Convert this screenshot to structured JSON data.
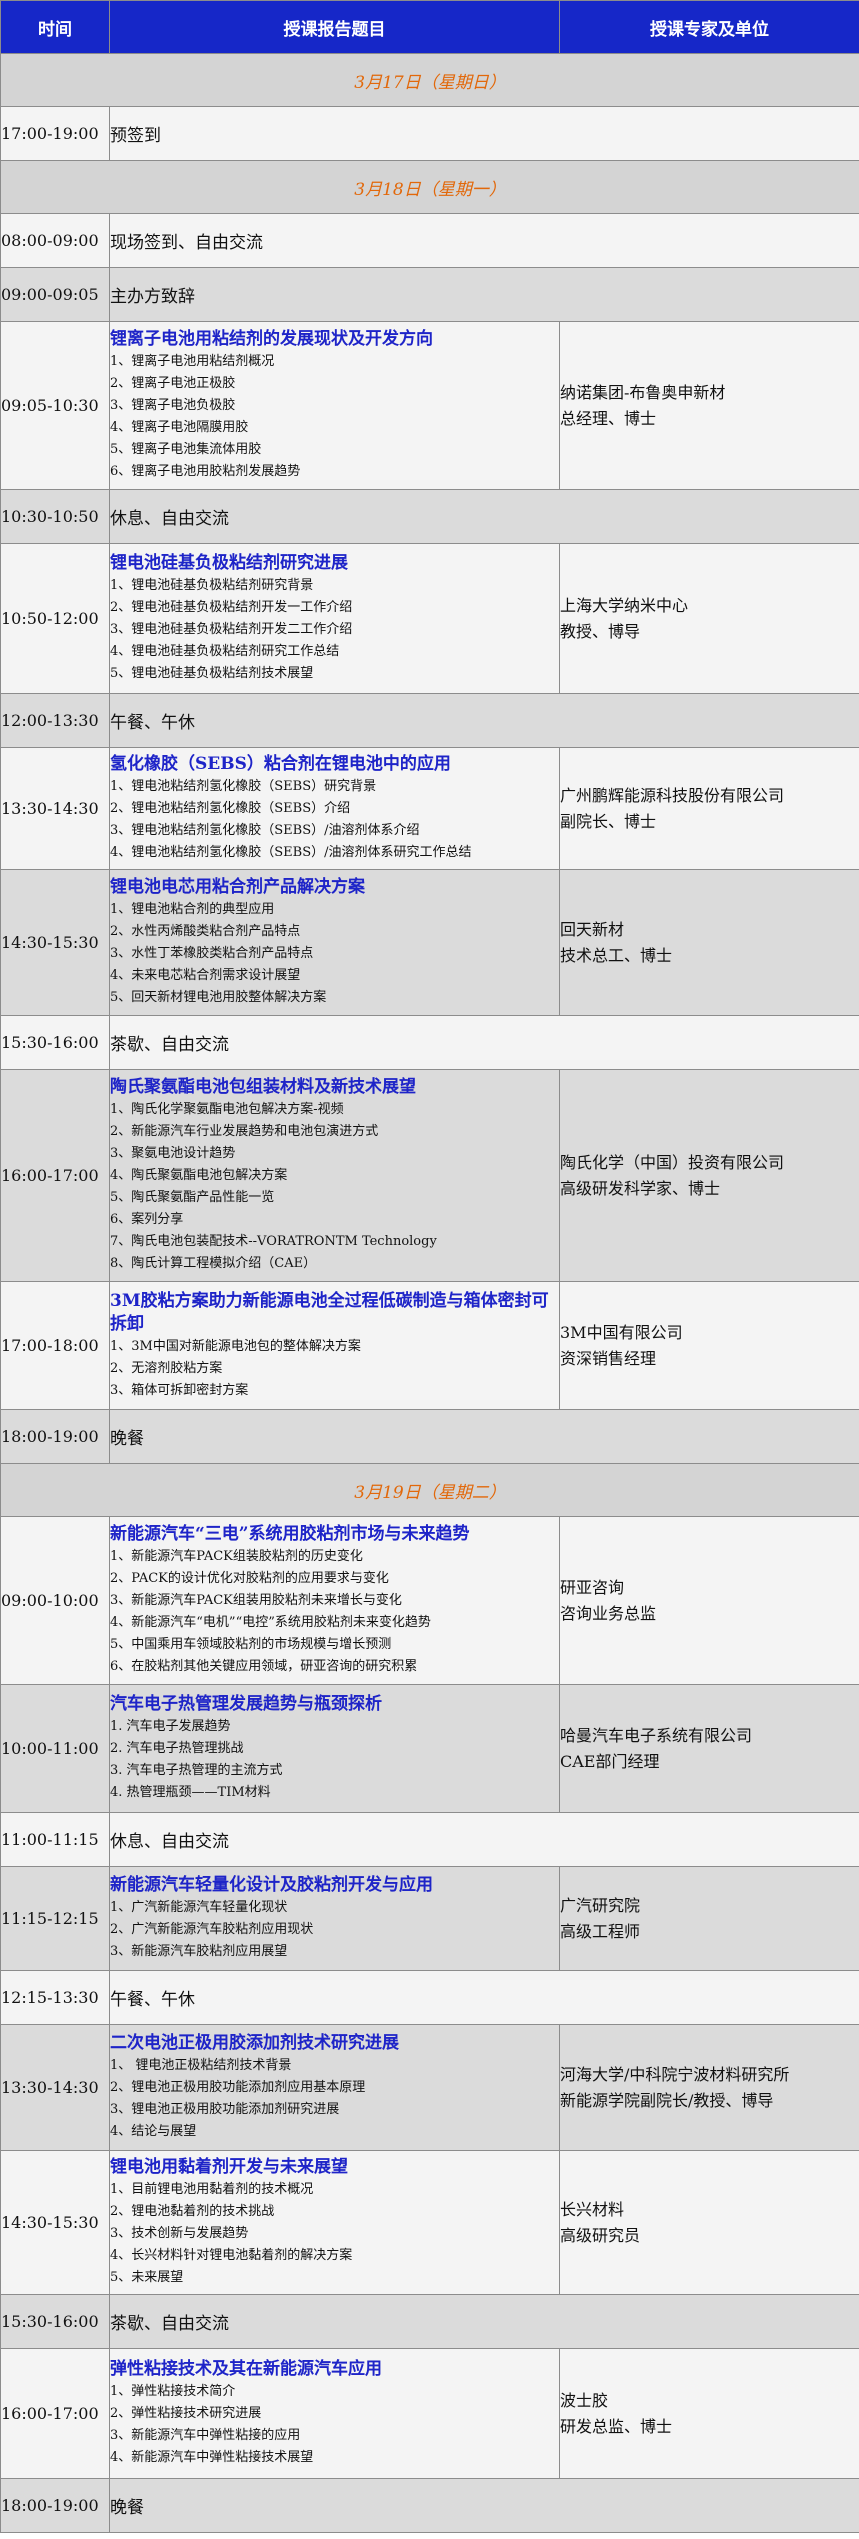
{
  "header": {
    "time": "时间",
    "topic": "授课报告题目",
    "expert": "授课专家及单位"
  },
  "days": [
    {
      "label": "3月17日（星期日）",
      "rows": [
        {
          "time": "17:00-19:00",
          "simple": "预签到",
          "h": 54
        }
      ]
    },
    {
      "label": "3月18日（星期一）",
      "rows": [
        {
          "time": "08:00-09:00",
          "simple": "现场签到、自由交流",
          "h": 54
        },
        {
          "time": "09:00-09:05",
          "simple": "主办方致辞",
          "h": 54
        },
        {
          "time": "09:05-10:30",
          "h": 168,
          "title": "锂离子电池用粘结剂的发展现状及开发方向",
          "items": [
            "1、锂离子电池用粘结剂概况",
            "2、锂离子电池正极胶",
            "3、锂离子电池负极胶",
            "4、锂离子电池隔膜用胶",
            "5、锂离子电池集流体用胶",
            "6、锂离子电池用胶粘剂发展趋势"
          ],
          "expert": [
            "纳诺集团-布鲁奥申新材",
            "总经理、博士"
          ]
        },
        {
          "time": "10:30-10:50",
          "simple": "休息、自由交流",
          "h": 54
        },
        {
          "time": "10:50-12:00",
          "h": 150,
          "title": "锂电池硅基负极粘结剂研究进展",
          "items": [
            "1、锂电池硅基负极粘结剂研究背景",
            "2、锂电池硅基负极粘结剂开发一工作介绍",
            "3、锂电池硅基负极粘结剂开发二工作介绍",
            "4、锂电池硅基负极粘结剂研究工作总结",
            "5、锂电池硅基负极粘结剂技术展望"
          ],
          "expert": [
            "上海大学纳米中心",
            "教授、博导"
          ]
        },
        {
          "time": "12:00-13:30",
          "simple": "午餐、午休",
          "h": 54
        },
        {
          "time": "13:30-14:30",
          "h": 122,
          "title": "氢化橡胶（SEBS）粘合剂在锂电池中的应用",
          "items": [
            "1、锂电池粘结剂氢化橡胶（SEBS）研究背景",
            "2、锂电池粘结剂氢化橡胶（SEBS）介绍",
            "3、锂电池粘结剂氢化橡胶（SEBS）/油溶剂体系介绍",
            "4、锂电池粘结剂氢化橡胶（SEBS）/油溶剂体系研究工作总结"
          ],
          "expert": [
            "广州鹏辉能源科技股份有限公司",
            "副院长、博士"
          ]
        },
        {
          "time": "14:30-15:30",
          "h": 146,
          "title": "锂电池电芯用粘合剂产品解决方案",
          "items": [
            "1、锂电池粘合剂的典型应用",
            "2、水性丙烯酸类粘合剂产品特点",
            "3、水性丁苯橡胶类粘合剂产品特点",
            "4、未来电芯粘合剂需求设计展望",
            "5、回天新材锂电池用胶整体解决方案"
          ],
          "expert": [
            "回天新材",
            "技术总工、博士"
          ]
        },
        {
          "time": "15:30-16:00",
          "simple": "茶歇、自由交流",
          "h": 54
        },
        {
          "time": "16:00-17:00",
          "h": 212,
          "title": "陶氏聚氨酯电池包组装材料及新技术展望",
          "items": [
            "1、陶氏化学聚氨酯电池包解决方案-视频",
            "2、新能源汽车行业发展趋势和电池包演进方式",
            "3、聚氨电池设计趋势",
            "4、陶氏聚氨酯电池包解决方案",
            "5、陶氏聚氨酯产品性能一览",
            "6、案列分享",
            "7、陶氏电池包装配技术--VORATRONTM Technology",
            "8、陶氏计算工程模拟介绍（CAE）"
          ],
          "expert": [
            "陶氏化学（中国）投资有限公司",
            "高级研发科学家、博士"
          ]
        },
        {
          "time": "17:00-18:00",
          "h": 128,
          "title": "3M胶粘方案助力新能源电池全过程低碳制造与箱体密封可拆卸",
          "items": [
            "1、3M中国对新能源电池包的整体解决方案",
            "2、无溶剂胶粘方案",
            "3、箱体可拆卸密封方案"
          ],
          "expert": [
            "3M中国有限公司",
            "资深销售经理"
          ]
        },
        {
          "time": "18:00-19:00",
          "simple": "晚餐",
          "h": 54
        }
      ]
    },
    {
      "label": "3月19日（星期二）",
      "rows": [
        {
          "time": "09:00-10:00",
          "h": 168,
          "title": "新能源汽车“三电”系统用胶粘剂市场与未来趋势",
          "items": [
            "1、新能源汽车PACK组装胶粘剂的历史变化",
            "2、PACK的设计优化对胶粘剂的应用要求与变化",
            "3、新能源汽车PACK组装用胶粘剂未来增长与变化",
            "4、新能源汽车“电机”“电控”系统用胶粘剂未来变化趋势",
            "5、中国乘用车领域胶粘剂的市场规模与增长预测",
            "6、在胶粘剂其他关键应用领域，研亚咨询的研究积累"
          ],
          "expert": [
            "研亚咨询",
            "咨询业务总监"
          ]
        },
        {
          "time": "10:00-11:00",
          "h": 128,
          "title": "汽车电子热管理发展趋势与瓶颈探析",
          "items": [
            "1. 汽车电子发展趋势",
            "2. 汽车电子热管理挑战",
            "3. 汽车电子热管理的主流方式",
            "4. 热管理瓶颈——TIM材料"
          ],
          "expert": [
            "哈曼汽车电子系统有限公司",
            "CAE部门经理"
          ]
        },
        {
          "time": "11:00-11:15",
          "simple": "休息、自由交流",
          "h": 54
        },
        {
          "time": "11:15-12:15",
          "h": 104,
          "title": "新能源汽车轻量化设计及胶粘剂开发与应用",
          "items": [
            "1、广汽新能源汽车轻量化现状",
            "2、广汽新能源汽车胶粘剂应用现状",
            "3、新能源汽车胶粘剂应用展望"
          ],
          "expert": [
            "广汽研究院",
            "高级工程师"
          ]
        },
        {
          "time": "12:15-13:30",
          "simple": "午餐、午休",
          "h": 54
        },
        {
          "time": "13:30-14:30",
          "h": 126,
          "title": "二次电池正极用胶添加剂技术研究进展",
          "items": [
            "1、 锂电池正极粘结剂技术背景",
            "2、锂电池正极用胶功能添加剂应用基本原理",
            "3、锂电池正极用胶功能添加剂研究进展",
            "4、结论与展望"
          ],
          "expert": [
            "河海大学/中科院宁波材料研究所",
            "新能源学院副院长/教授、博导"
          ]
        },
        {
          "time": "14:30-15:30",
          "h": 144,
          "title": "锂电池用黏着剂开发与未来展望",
          "items": [
            "1、目前锂电池用黏着剂的技术概况",
            "2、锂电池黏着剂的技术挑战",
            "3、技术创新与发展趋势",
            "4、长兴材料针对锂电池黏着剂的解决方案",
            "5、未来展望"
          ],
          "expert": [
            "长兴材料",
            "高级研究员"
          ]
        },
        {
          "time": "15:30-16:00",
          "simple": "茶歇、自由交流",
          "h": 54
        },
        {
          "time": "16:00-17:00",
          "h": 130,
          "title": "弹性粘接技术及其在新能源汽车应用",
          "items": [
            "1、弹性粘接技术简介",
            "2、弹性粘接技术研究进展",
            "3、新能源汽车中弹性粘接的应用",
            "4、新能源汽车中弹性粘接技术展望"
          ],
          "expert": [
            "波士胶",
            "研发总监、博士"
          ]
        },
        {
          "time": "18:00-19:00",
          "simple": "晚餐",
          "h": 54
        }
      ]
    }
  ]
}
